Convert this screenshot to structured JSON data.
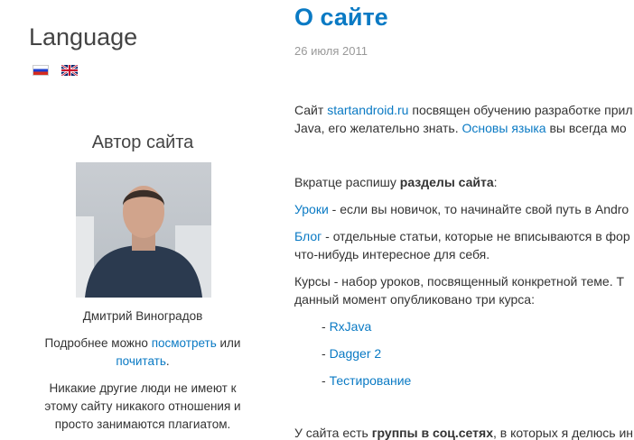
{
  "sidebar": {
    "language_title": "Language",
    "flags": [
      "flag-ru-icon",
      "flag-uk-icon"
    ],
    "author_title": "Автор сайта",
    "author_name": "Дмитрий Виноградов",
    "more_prefix": "Подробнее можно",
    "more_link1": "посмотреть",
    "more_mid": "или",
    "more_link2": "почитать",
    "more_suffix": ".",
    "disclaimer_lines": [
      "Никакие другие люди не имеют к",
      "этому сайту никакого отношения и",
      "просто занимаются плагиатом."
    ]
  },
  "post": {
    "title": "О сайте",
    "date": "26 июля 2011",
    "p1_a": "Сайт ",
    "p1_link": "startandroid.ru",
    "p1_b": " посвящен обучению разработке прил",
    "p1_c": "Java, его желательно знать. ",
    "p1_link2": "Основы языка",
    "p1_d": " вы всегда мо",
    "p2_a": "Вкратце распишу ",
    "p2_bold": "разделы сайта",
    "p2_b": ":",
    "lessons_link": "Уроки",
    "lessons_text": " - если вы новичок, то начинайте свой путь в Andro",
    "blog_link": "Блог",
    "blog_text": " - отдельные статьи, которые не вписываются в фор",
    "blog_text2": "что-нибудь интересное для себя.",
    "courses_text": "Курсы - набор уроков, посвященный конкретной теме. Т",
    "courses_text2": "данный момент опубликовано три курса:",
    "dash": "- ",
    "courses": [
      "RxJava",
      "Dagger 2",
      "Тестирование"
    ],
    "social_a": "У сайта есть ",
    "social_bold": "группы в соц.сетях",
    "social_b": ", в которых я делюсь ин"
  }
}
